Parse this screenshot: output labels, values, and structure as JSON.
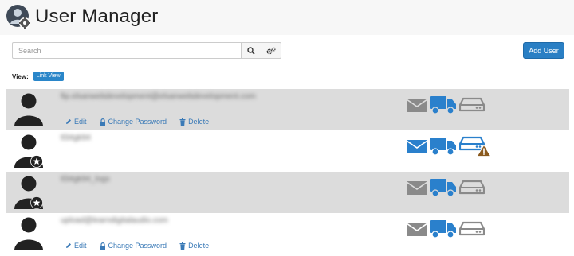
{
  "header": {
    "title": "User Manager"
  },
  "search": {
    "placeholder": "Search",
    "value": ""
  },
  "toolbar": {
    "add_user_label": "Add User"
  },
  "view": {
    "label": "View:",
    "mode": "Link View"
  },
  "colors": {
    "accent": "#2a7fc4",
    "service_enabled": "#2a80cc",
    "service_disabled": "#8a8a8a",
    "warning": "#8a5a1e",
    "row_shade": "#dcdcdc"
  },
  "users": [
    {
      "username": "ftp.elsanwebdevelopment@elsanwebdevelopment.com",
      "avatar_badge": "none",
      "show_actions": true,
      "services": {
        "email": "disabled",
        "ftp": "enabled",
        "webdisk": "disabled",
        "webdisk_warning": false
      }
    },
    {
      "username": "tl34gk94",
      "avatar_badge": "star",
      "show_actions": false,
      "services": {
        "email": "enabled",
        "ftp": "enabled",
        "webdisk": "enabled",
        "webdisk_warning": true
      }
    },
    {
      "username": "tl34gk94_logs",
      "avatar_badge": "star",
      "show_actions": false,
      "services": {
        "email": "disabled",
        "ftp": "enabled",
        "webdisk": "disabled",
        "webdisk_warning": false
      }
    },
    {
      "username": "upload@learndigitalaudio.com",
      "avatar_badge": "none",
      "show_actions": true,
      "services": {
        "email": "disabled",
        "ftp": "enabled",
        "webdisk": "disabled",
        "webdisk_warning": false
      }
    }
  ],
  "row_actions": {
    "edit_label": "Edit",
    "change_password_label": "Change Password",
    "delete_label": "Delete"
  },
  "icons": {
    "logo": "user-gear-logo-icon",
    "search": "search-icon",
    "advanced": "gears-icon",
    "avatar": "user-avatar-icon",
    "edit": "pencil-icon",
    "password": "lock-icon",
    "delete": "trash-icon",
    "email": "envelope-icon",
    "ftp": "truck-icon",
    "webdisk": "drive-icon",
    "warning": "warning-icon"
  }
}
